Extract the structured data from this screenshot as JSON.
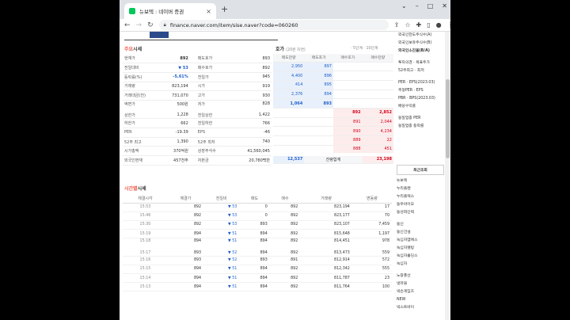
{
  "browser": {
    "tab_title": "뉴보텍 : 네이버 증권",
    "url": "finance.naver.com/item/sise.naver?code=060260"
  },
  "sections": {
    "main_quote_prefix": "주요",
    "main_quote_suffix": "시세",
    "orderbook_title": "호가",
    "orderbook_sub": "(20분 지연)",
    "orderbook_links": "· 5단계  · 10단계",
    "time_prefix": "시간별",
    "time_suffix": "시세"
  },
  "quote": {
    "left": [
      {
        "label": "현재가",
        "value": "892"
      },
      {
        "label": "전일대비",
        "value": "▼ 53"
      },
      {
        "label": "등락률(%)",
        "value": "-5.61%"
      },
      {
        "label": "거래량",
        "value": "823,194"
      },
      {
        "label": "거래대금(천)",
        "value": "731,070"
      },
      {
        "label": "액면가",
        "value": "500원"
      },
      {
        "label": "상한가",
        "value": "1,228"
      },
      {
        "label": "하한가",
        "value": "662"
      },
      {
        "label": "PER",
        "value": "-19.39"
      },
      {
        "label": "52주 최고",
        "value": "1,390"
      },
      {
        "label": "시가총액",
        "value": "370억원"
      },
      {
        "label": "외국인현재",
        "value": "457천주"
      }
    ],
    "right": [
      {
        "label": "매도호가",
        "value": "893"
      },
      {
        "label": "매수호가",
        "value": "892"
      },
      {
        "label": "전일가",
        "value": "945"
      },
      {
        "label": "시가",
        "value": "919"
      },
      {
        "label": "고가",
        "value": "930"
      },
      {
        "label": "저가",
        "value": "828"
      },
      {
        "label": "전일상한",
        "value": "1,422"
      },
      {
        "label": "전일하한",
        "value": "766"
      },
      {
        "label": "EPS",
        "value": "-46"
      },
      {
        "label": "52주 최저",
        "value": "740"
      },
      {
        "label": "상장주식수",
        "value": "41,560,045"
      },
      {
        "label": "자본금",
        "value": "20,780백만"
      }
    ]
  },
  "orderbook": {
    "headers": [
      "매도잔량",
      "매도호가",
      "매수호가",
      "매수잔량"
    ],
    "asks": [
      {
        "qty": "2,950",
        "price": "897"
      },
      {
        "qty": "4,400",
        "price": "896"
      },
      {
        "qty": "414",
        "price": "895"
      },
      {
        "qty": "2,376",
        "price": "894"
      },
      {
        "qty": "1,064",
        "price": "893"
      }
    ],
    "bids": [
      {
        "price": "892",
        "qty": "2,852"
      },
      {
        "price": "891",
        "qty": "2,044"
      },
      {
        "price": "890",
        "qty": "4,234"
      },
      {
        "price": "889",
        "qty": "22"
      },
      {
        "price": "888",
        "qty": "451"
      }
    ],
    "total_ask": "12,537",
    "total_label": "잔량합계",
    "total_bid": "23,198"
  },
  "time_table": {
    "headers": [
      "체결시각",
      "체결가",
      "전일비",
      "매도",
      "매수",
      "거래량",
      "변동량"
    ],
    "rows": [
      [
        "15:53",
        "892",
        "▼ 53",
        "0",
        "892",
        "823,194",
        "17"
      ],
      [
        "15:46",
        "892",
        "▼ 53",
        "0",
        "892",
        "823,177",
        "70"
      ],
      [
        "15:30",
        "892",
        "▼ 53",
        "893",
        "892",
        "823,107",
        "7,459"
      ],
      [
        "15:19",
        "894",
        "▼ 51",
        "894",
        "892",
        "815,648",
        "1,197"
      ],
      [
        "15:18",
        "894",
        "▼ 51",
        "894",
        "892",
        "814,451",
        "978"
      ],
      [
        "15:17",
        "893",
        "▼ 52",
        "894",
        "892",
        "813,473",
        "559"
      ],
      [
        "15:16",
        "893",
        "▼ 52",
        "893",
        "891",
        "812,914",
        "572"
      ],
      [
        "15:15",
        "894",
        "▼ 51",
        "894",
        "892",
        "812,342",
        "555"
      ],
      [
        "15:14",
        "894",
        "▼ 51",
        "894",
        "892",
        "811,787",
        "23"
      ],
      [
        "15:13",
        "894",
        "▼ 51",
        "894",
        "892",
        "811,764",
        "100"
      ]
    ]
  },
  "sidebar": {
    "top": [
      "외국인한도주식수(A)",
      "외국인보유주식수(B)",
      "외국인소진율(B/A)",
      "",
      "투자의견 · 목표주가",
      "52주최고 · 최저",
      "",
      "PER · EPS(2023.03)",
      "추정PER · EPS",
      "PBR · BPS(2023.03)",
      "배당수익률",
      "",
      "동일업종 PER",
      "동일업종 등락률"
    ],
    "recent_tab": "최근조회",
    "recent": [
      "뉴보텍",
      "누리플랜",
      "누리플렉스",
      "동우바이오",
      "동성화인텍",
      "",
      "동신",
      "동신건설",
      "녹십자엠에스",
      "녹십자웰빙",
      "녹십자홀딩스",
      "녹십자",
      "",
      "노랑풍선",
      "넷마블",
      "넥슨게임즈",
      "NEW",
      "넥스트바이"
    ]
  }
}
